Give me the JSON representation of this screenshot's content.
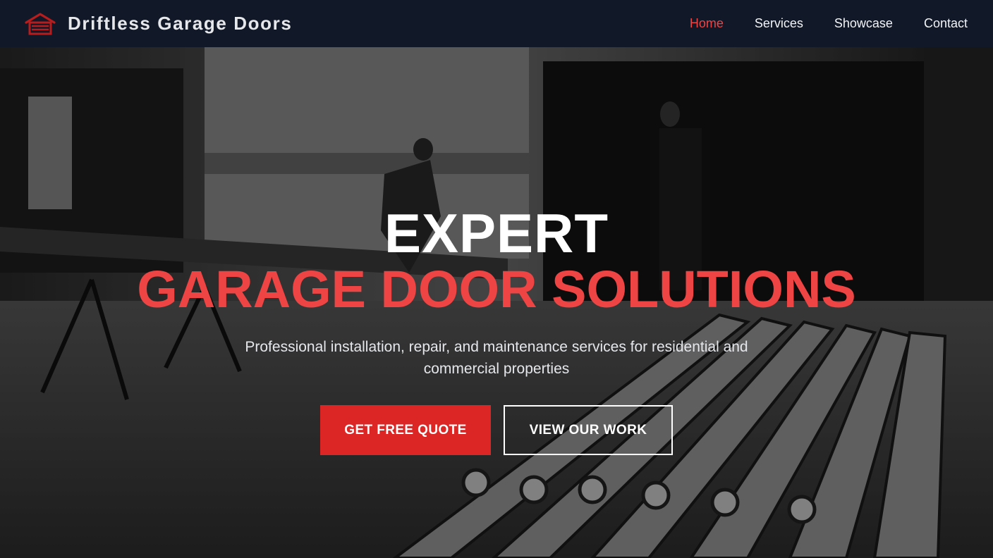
{
  "brand": {
    "name": "Driftless Garage Doors",
    "logo_icon": "garage-icon",
    "logo_color": "#b91c1c"
  },
  "nav": {
    "items": [
      {
        "label": "Home",
        "active": true
      },
      {
        "label": "Services",
        "active": false
      },
      {
        "label": "Showcase",
        "active": false
      },
      {
        "label": "Contact",
        "active": false
      }
    ]
  },
  "hero": {
    "title_line1": "EXPERT",
    "title_line2": "GARAGE DOOR SOLUTIONS",
    "subtitle": "Professional installation, repair, and maintenance services for residential and commercial properties",
    "primary_button": "GET FREE QUOTE",
    "secondary_button": "VIEW OUR WORK"
  },
  "colors": {
    "nav_bg": "#111827",
    "accent": "#ef4444",
    "button_red": "#dc2626",
    "text_light": "#e5e7eb"
  }
}
